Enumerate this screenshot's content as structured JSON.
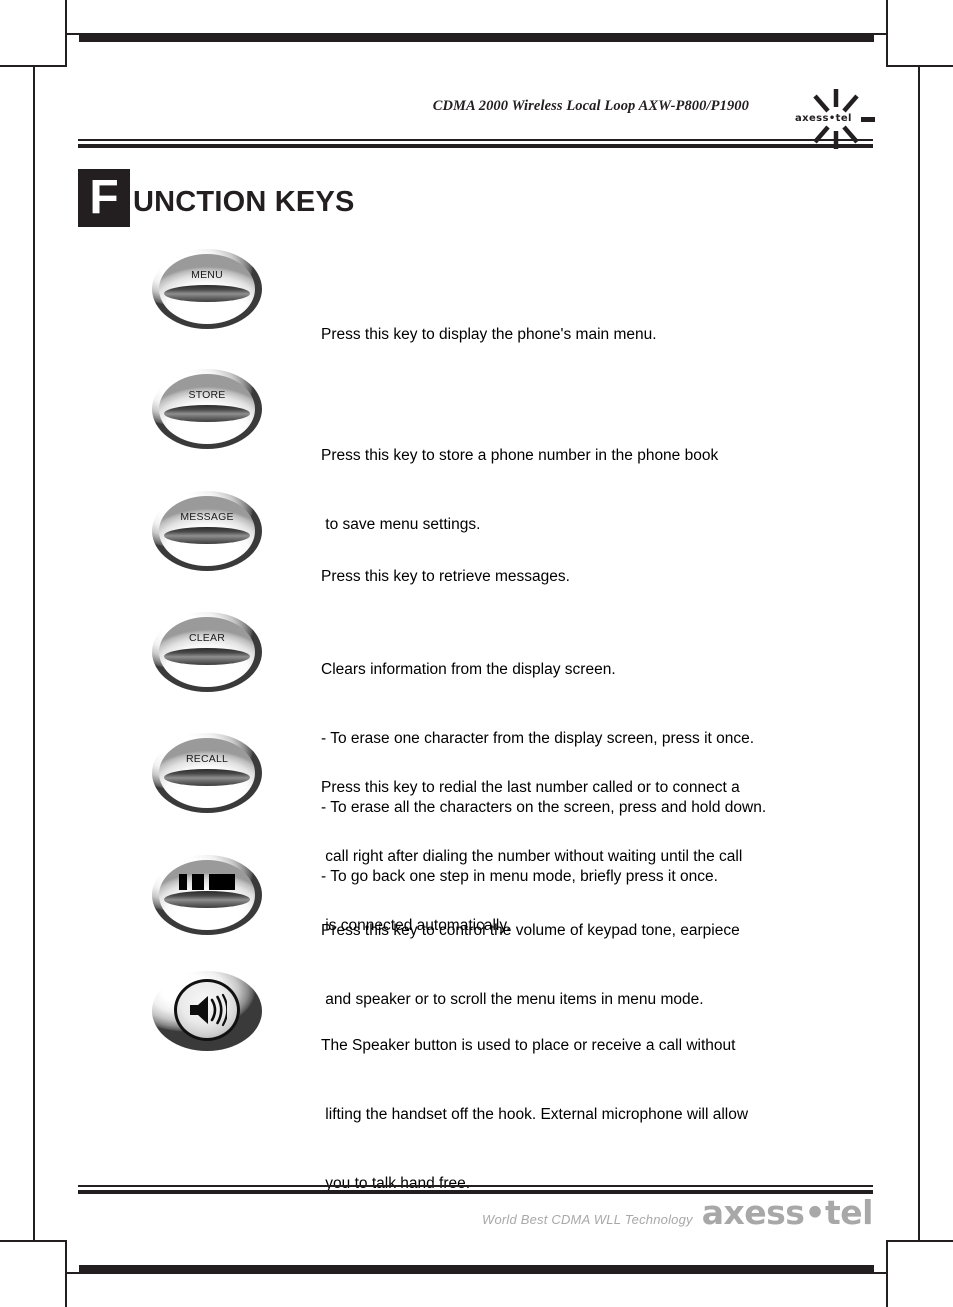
{
  "header": {
    "document_title": "CDMA 2000 Wireless Local Loop AXW-P800/P1900",
    "logo_text": "axess•tel"
  },
  "section": {
    "title_initial": "F",
    "title_rest": "UNCTION KEYS"
  },
  "keys": [
    {
      "label": "MENU",
      "icon": "none",
      "lines": [
        "Press this key to display the phone's main menu."
      ]
    },
    {
      "label": "STORE",
      "icon": "none",
      "lines": [
        "Press this key to store a phone number in the phone book",
        " to save menu settings."
      ]
    },
    {
      "label": "MESSAGE",
      "icon": "none",
      "lines": [
        "Press this key to retrieve messages."
      ]
    },
    {
      "label": "CLEAR",
      "icon": "none",
      "lines": [
        "Clears information from the display screen.",
        "- To erase one character from the display screen, press it once.",
        "- To erase all the characters on the screen, press and hold down.",
        "- To go back one step in menu mode, briefly press it once."
      ]
    },
    {
      "label": "RECALL",
      "icon": "none",
      "lines": [
        "Press this key to redial the last number called or to connect a",
        " call right after dialing the number without waiting until the call",
        " is connected automatically."
      ]
    },
    {
      "label": "",
      "icon": "volume-bars-icon",
      "lines": [
        "Press this key to control the volume of keypad tone, earpiece",
        " and speaker or to scroll the menu items in menu mode."
      ]
    },
    {
      "label": "",
      "icon": "speaker-icon",
      "lines": [
        "The Speaker button is used to place or receive a call without",
        " lifting the handset off the hook. External microphone will allow",
        " you to talk hand free."
      ]
    }
  ],
  "footer": {
    "tagline": "World Best CDMA WLL Technology",
    "brand": "axess•tel"
  },
  "colors": {
    "ink": "#231f20",
    "footer_gray": "#a8a8a8",
    "badge_bg": "#231f20"
  }
}
